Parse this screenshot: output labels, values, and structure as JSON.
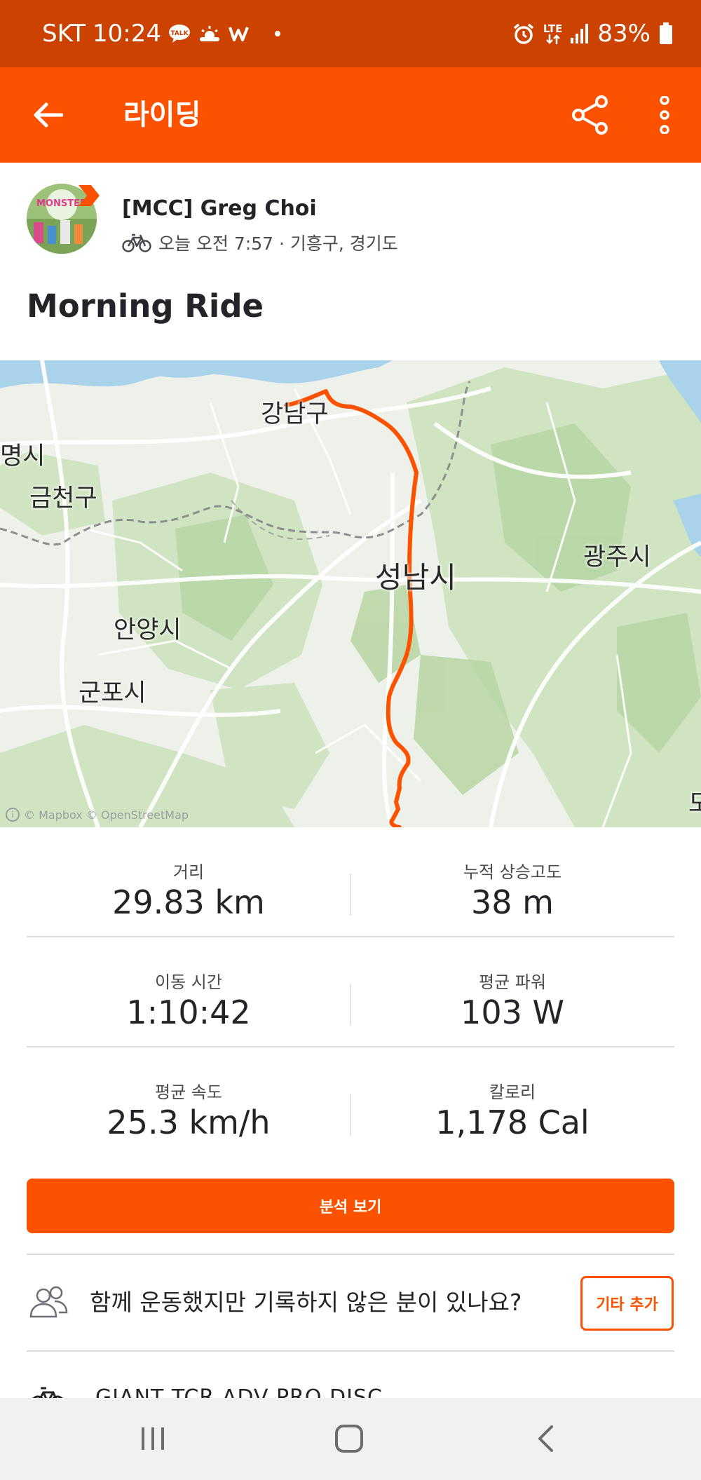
{
  "status_bar": {
    "carrier": "SKT",
    "time": "10:24",
    "network": "LTE",
    "battery": "83%"
  },
  "app_bar": {
    "title": "라이딩"
  },
  "athlete": {
    "name": "[MCC] Greg Choi",
    "meta": "오늘 오전 7:57 · 기흥구, 경기도",
    "avatar_text": "MONSTER"
  },
  "activity": {
    "title": "Morning Ride"
  },
  "map": {
    "labels": {
      "gangnam": "강남구",
      "gwangmyeong": "명시",
      "geumcheon": "금천구",
      "seongnam": "성남시",
      "gwangju": "광주시",
      "anyang": "안양시",
      "gunpo": "군포시",
      "edge": "도"
    },
    "attribution": "© Mapbox © OpenStreetMap",
    "route_color": "#fc5200"
  },
  "stats": {
    "distance": {
      "label": "거리",
      "value": "29.83 km"
    },
    "elevation": {
      "label": "누적 상승고도",
      "value": "38 m"
    },
    "moving_time": {
      "label": "이동 시간",
      "value": "1:10:42"
    },
    "avg_power": {
      "label": "평균 파워",
      "value": "103 W"
    },
    "avg_speed": {
      "label": "평균 속도",
      "value": "25.3 km/h"
    },
    "calories": {
      "label": "칼로리",
      "value": "1,178 Cal"
    }
  },
  "analyze_button": "분석 보기",
  "add_others": {
    "text": "함께 운동했지만 기록하지 않은 분이 있나요?",
    "button": "기타 추가"
  },
  "gear": {
    "name": "GIANT TCR ADV PRO DISC"
  },
  "colors": {
    "accent": "#fc5200",
    "status_bar": "#cc4200"
  }
}
